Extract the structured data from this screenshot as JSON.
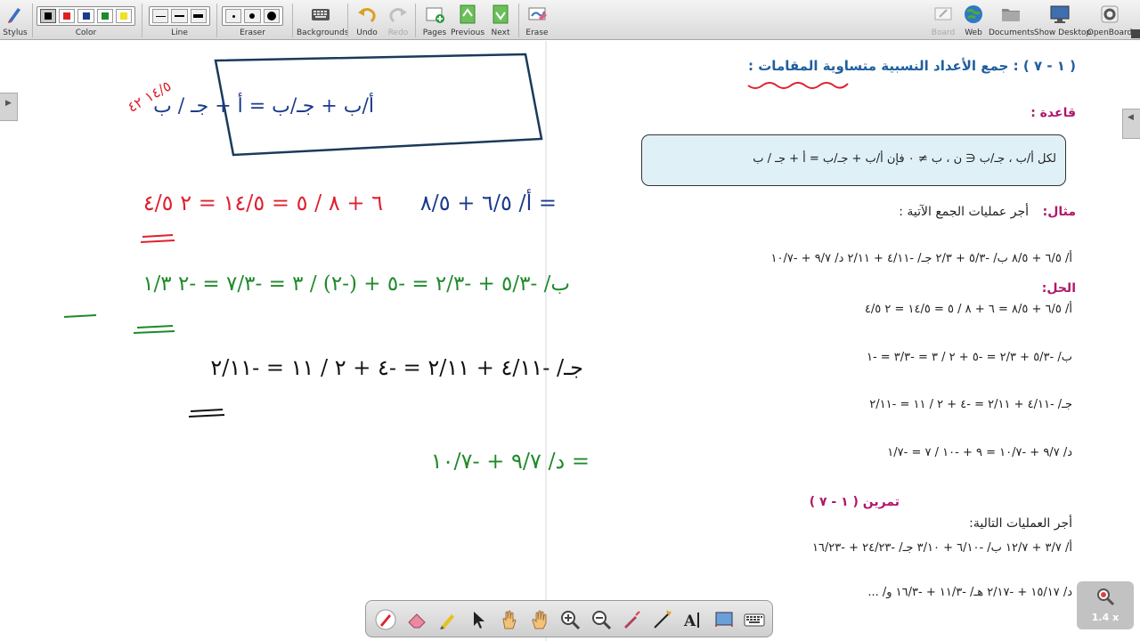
{
  "toolbar": {
    "stylus_label": "Stylus",
    "color_label": "Color",
    "line_label": "Line",
    "eraser_label": "Eraser",
    "backgrounds_label": "Backgrounds",
    "undo_label": "Undo",
    "redo_label": "Redo",
    "pages_label": "Pages",
    "previous_label": "Previous",
    "next_label": "Next",
    "erase_label": "Erase",
    "board_label": "Board",
    "web_label": "Web",
    "documents_label": "Documents",
    "show_desktop_label": "Show Desktop",
    "openboard_label": "OpenBoard",
    "colors": [
      "#000000",
      "#e02020",
      "#1a3a8a",
      "#1e8a2a",
      "#f2e020"
    ]
  },
  "lesson": {
    "title": "( ١ - ٧ ) : جمع الأعداد النسبية متساوية المقامات :",
    "rule_heading": "قاعدة :",
    "rule_text": "لكل أ/ب ، جـ/ب ∈ ن ، ب ≠ ٠ فإن أ/ب + جـ/ب = أ + جـ / ب",
    "example_heading": "مثال:",
    "example_prompt": "أجر عمليات الجمع الآتية :",
    "example_items": "أ/ ٦/٥ + ٨/٥     ب/ -٥/٣ + ٢/٣     جـ/ -٤/١١ + ٢/١١     د/ ٩/٧ + -١٠/٧",
    "solution_heading": "الحل:",
    "sol_a": "أ/   ٦/٥ + ٨/٥ = ٦ + ٨ / ٥ = ١٤/٥ = ٢ ٤/٥",
    "sol_b": "ب/   -٥/٣ + ٢/٣ = -٥ + ٢ / ٣ = -٣/٣ = -١",
    "sol_c": "جـ/   -٤/١١ + ٢/١١ = -٤ + ٢ / ١١ = -٢/١١",
    "sol_d": "د/   ٩/٧ + -١٠/٧ = ٩ + -١٠ / ٧ = -١/٧",
    "exercise_heading": "تمرين ( ١ - ٧ )",
    "exercise_prompt": "أجر العمليات التالية:",
    "exercise_row1": "أ/ ٣/٧ + ١٢/٧     ب/ -٦/١٠ + ٣/١٠     جـ/ -٢٤/٢٣ + -١٦/٢٣",
    "exercise_row2": "د/ ١٥/١٧ + -٢/١٧     هـ/ -١١/٣ + -١٦/٣     و/ ..."
  },
  "handwriting": {
    "box_formula": "أ/ب + جـ/ب = أ + جـ / ب",
    "line_a_blue": "أ/ ٦/٥ + ٨/٥ =",
    "line_a_red": "٦ + ٨ / ٥ = ١٤/٥ = ٢ ٤/٥",
    "line_b": "ب/ -٥/٣ + -٢/٣ = -٥ + (-٢) / ٣ = -٧/٣ = -٢ ١/٣",
    "line_c": "جـ/ -٤/١١ + ٢/١١ = -٤ + ٢ / ١١ = -٢/١١",
    "line_d": "د/ ٩/٧ + -١٠/٧ =",
    "corner_note": "١٤/٥ ٤٢"
  },
  "zoom": {
    "label": "1.4 x"
  }
}
